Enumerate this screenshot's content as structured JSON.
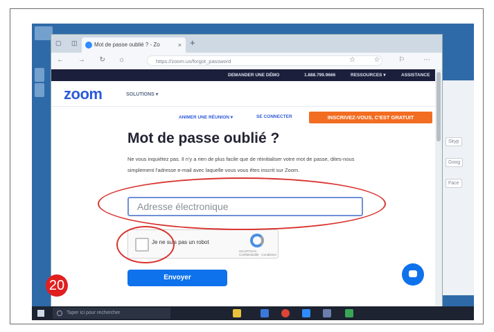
{
  "badge": "20",
  "browser": {
    "tab_title": "Mot de passe oublié ? - Zo",
    "tab_close": "×",
    "new_tab": "+",
    "url": "https://zoom.us/forgot_password"
  },
  "zoom": {
    "topnav": {
      "demo": "DEMANDER UNE DÉMO",
      "phone": "1.888.799.9666",
      "resources": "RESSOURCES ▾",
      "support": "ASSISTANCE"
    },
    "logo": "zoom",
    "solutions": "SOLUTIONS ▾",
    "join": "ANIMER UNE RÉUNION ▾",
    "signin": "SE CONNECTER",
    "signup": "INSCRIVEZ-VOUS, C'EST GRATUIT",
    "title": "Mot de passe oublié ?",
    "description": "Ne vous inquiétez pas. Il n'y a rien de plus facile que de réinitialiser votre mot de passe, dites-nous simplement l'adresse e-mail avec laquelle vous vous êtes inscrit sur Zoom.",
    "email_placeholder": "Adresse électronique",
    "captcha_label": "Je ne suis pas un robot",
    "captcha_brand": "reCAPTCHA",
    "captcha_terms": "Confidentialité - Conditions",
    "submit": "Envoyer"
  },
  "taskbar": {
    "search_placeholder": "Taper ici pour rechercher"
  },
  "colors": {
    "zoom_blue": "#0e72ed",
    "signup_orange": "#f26d21",
    "annotation_red": "#d9332f"
  }
}
